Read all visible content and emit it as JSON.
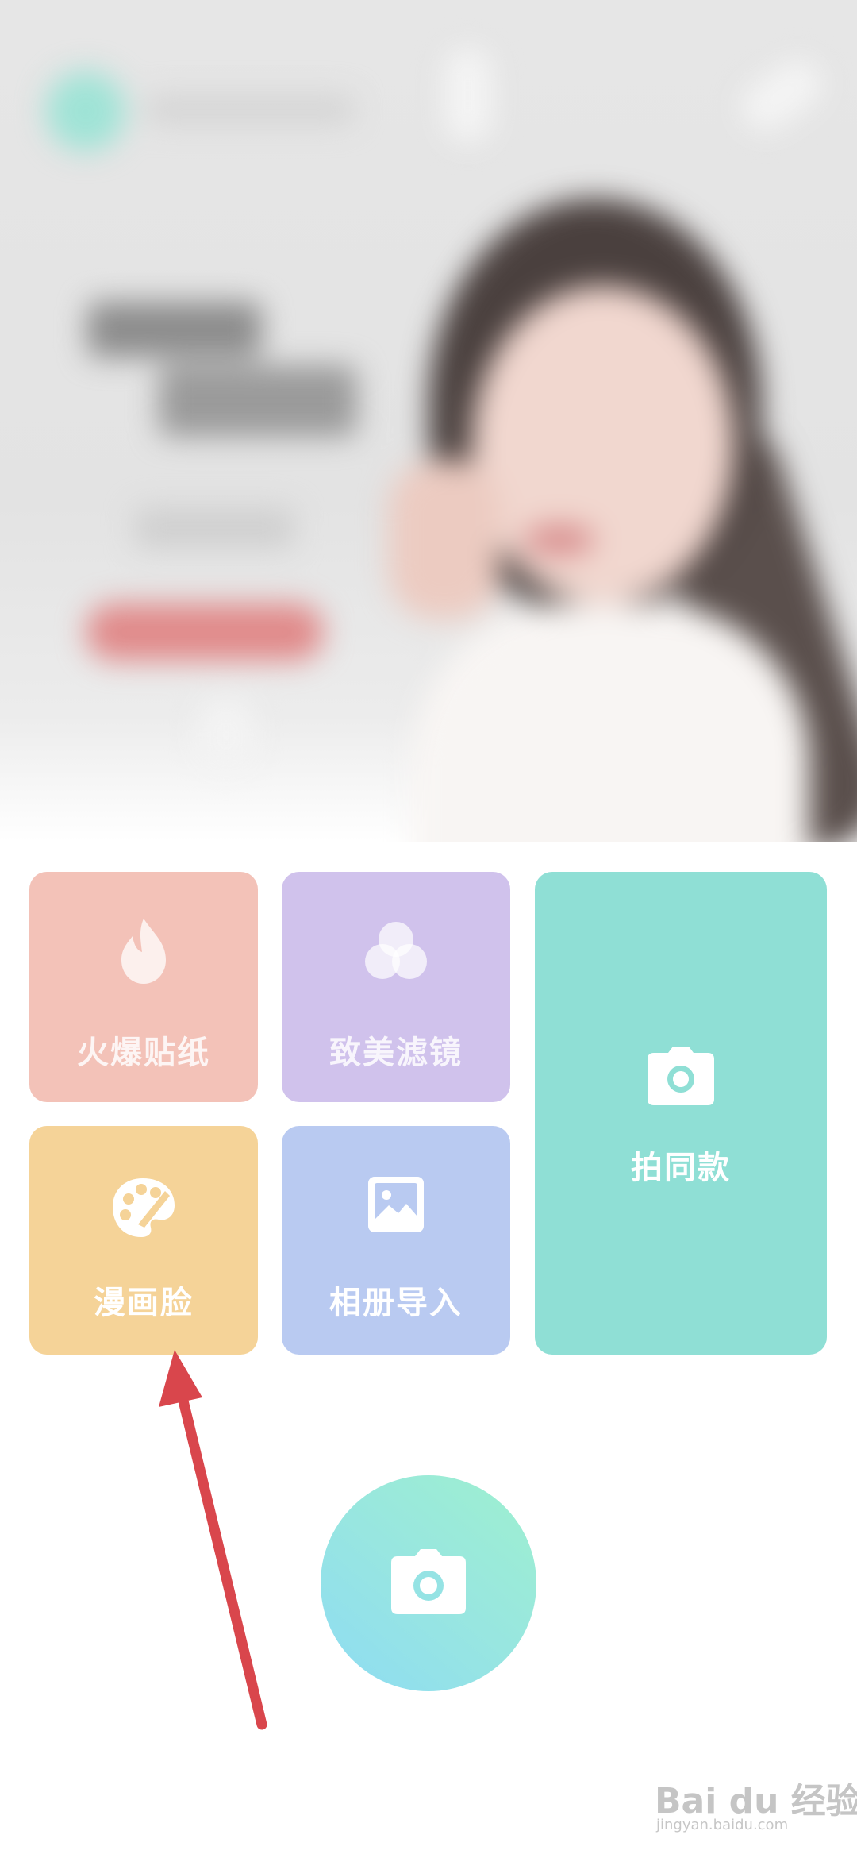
{
  "tiles": {
    "sticker": {
      "label": "火爆贴纸",
      "icon": "flame-icon"
    },
    "filter": {
      "label": "致美滤镜",
      "icon": "filter-circles-icon"
    },
    "same_style": {
      "label": "拍同款",
      "icon": "camera-icon"
    },
    "comic_face": {
      "label": "漫画脸",
      "icon": "palette-icon"
    },
    "album_import": {
      "label": "相册导入",
      "icon": "image-icon"
    }
  },
  "shutter": {
    "icon": "camera-icon"
  },
  "watermark": {
    "text": "Bai du 经验",
    "sub": "jingyan.baidu.com"
  },
  "colors": {
    "sticker": "#f3c2b8",
    "filter": "#d0c2ec",
    "same_style": "#8fdfd5",
    "comic_face": "#f5d398",
    "album_import": "#b9caf1",
    "arrow": "#d9464c"
  }
}
